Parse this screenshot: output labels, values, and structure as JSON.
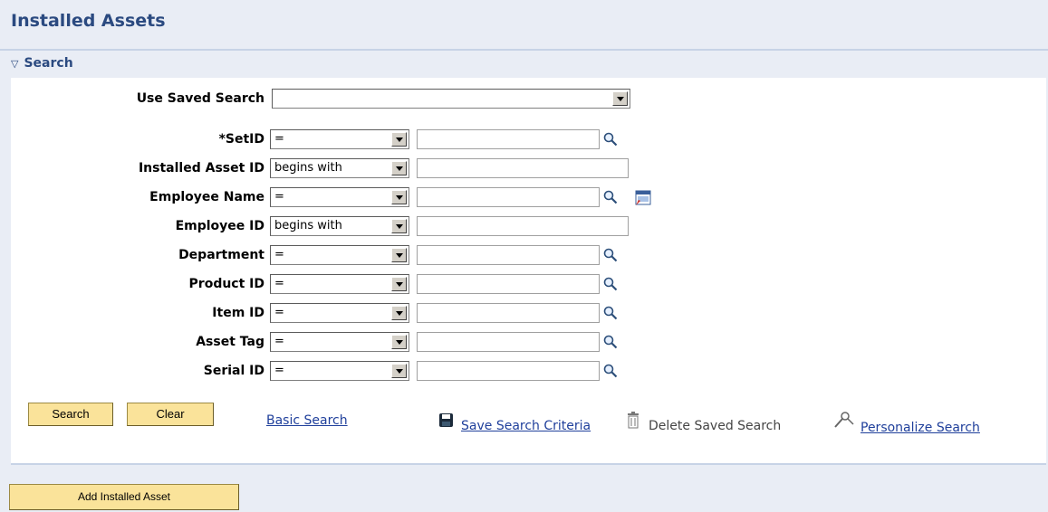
{
  "page": {
    "title": "Installed Assets"
  },
  "section": {
    "title": "Search"
  },
  "saved_search": {
    "label": "Use Saved Search",
    "value": ""
  },
  "fields": [
    {
      "label": "*SetID",
      "operator": "=",
      "value": "",
      "lookup": true,
      "calendar": false
    },
    {
      "label": "Installed Asset ID",
      "operator": "begins with",
      "value": "",
      "lookup": false,
      "calendar": false
    },
    {
      "label": "Employee Name",
      "operator": "=",
      "value": "",
      "lookup": true,
      "calendar": true
    },
    {
      "label": "Employee ID",
      "operator": "begins with",
      "value": "",
      "lookup": false,
      "calendar": false
    },
    {
      "label": "Department",
      "operator": "=",
      "value": "",
      "lookup": true,
      "calendar": false
    },
    {
      "label": "Product ID",
      "operator": "=",
      "value": "",
      "lookup": true,
      "calendar": false
    },
    {
      "label": "Item ID",
      "operator": "=",
      "value": "",
      "lookup": true,
      "calendar": false
    },
    {
      "label": "Asset Tag",
      "operator": "=",
      "value": "",
      "lookup": true,
      "calendar": false
    },
    {
      "label": "Serial ID",
      "operator": "=",
      "value": "",
      "lookup": true,
      "calendar": false
    }
  ],
  "actions": {
    "search": "Search",
    "clear": "Clear",
    "basic_search": "Basic Search",
    "save_criteria": "Save Search Criteria",
    "delete_saved": "Delete Saved Search",
    "personalize": "Personalize Search"
  },
  "add_button": "Add Installed Asset",
  "colors": {
    "title": "#2b4a80",
    "button": "#fae39a",
    "link": "#1f3f9b",
    "background": "#e9edf5"
  }
}
